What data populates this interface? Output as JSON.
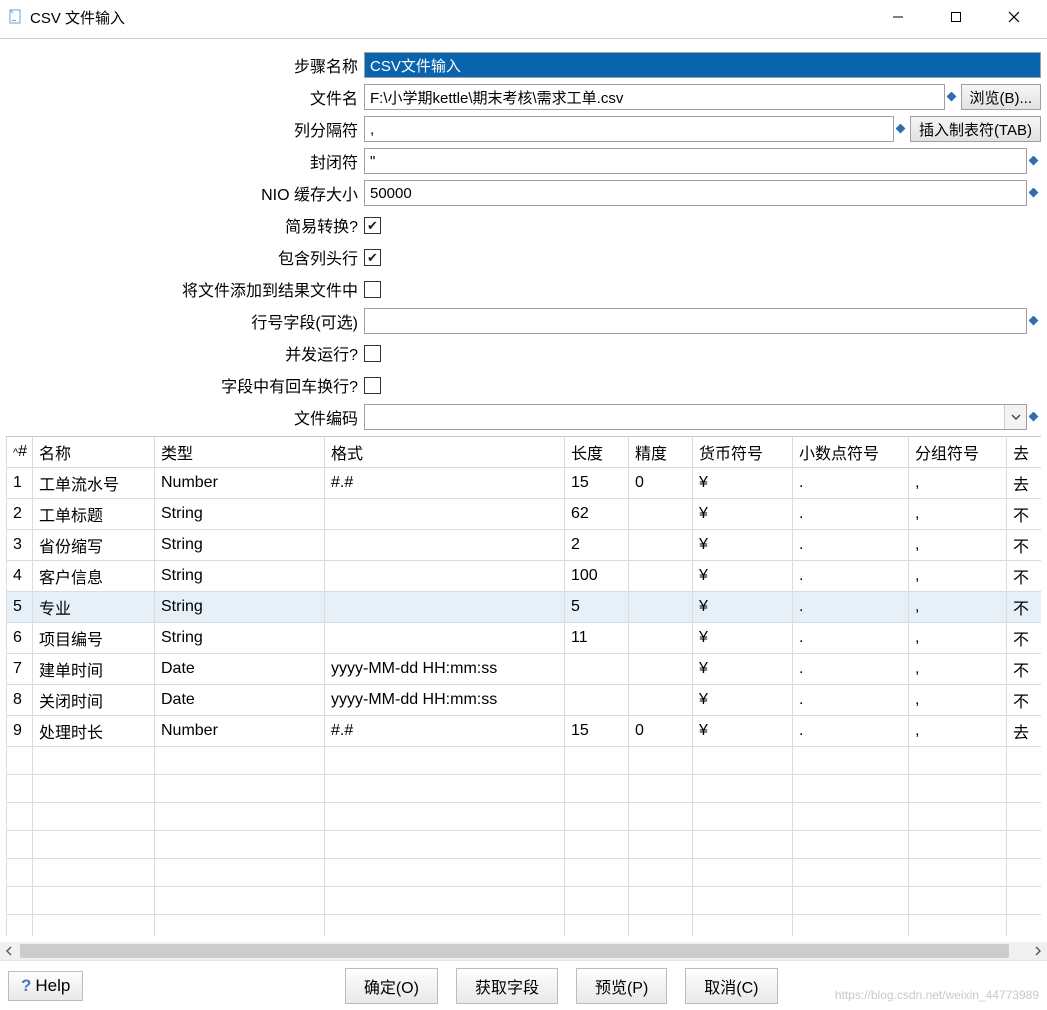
{
  "window": {
    "title": "CSV 文件输入"
  },
  "form": {
    "stepName": {
      "label": "步骤名称",
      "value": "CSV文件输入"
    },
    "fileName": {
      "label": "文件名",
      "value": "F:\\小学期kettle\\期末考核\\需求工单.csv",
      "browse": "浏览(B)..."
    },
    "delimiter": {
      "label": "列分隔符",
      "value": ",",
      "tabBtn": "插入制表符(TAB)"
    },
    "enclosure": {
      "label": "封闭符",
      "value": "\""
    },
    "nioBuffer": {
      "label": "NIO 缓存大小",
      "value": "50000"
    },
    "lazy": {
      "label": "简易转换?",
      "checked": true
    },
    "header": {
      "label": "包含列头行",
      "checked": true
    },
    "addResult": {
      "label": "将文件添加到结果文件中",
      "checked": false
    },
    "rowNum": {
      "label": "行号字段(可选)",
      "value": ""
    },
    "parallel": {
      "label": "并发运行?",
      "checked": false
    },
    "newlineIn": {
      "label": "字段中有回车换行?",
      "checked": false
    },
    "encoding": {
      "label": "文件编码",
      "value": ""
    }
  },
  "table": {
    "headers": {
      "idx": "#",
      "name": "名称",
      "type": "类型",
      "format": "格式",
      "length": "长度",
      "decimal": "精度",
      "currency": "货币符号",
      "decSym": "小数点符号",
      "grpSym": "分组符号",
      "trim": "去"
    },
    "rows": [
      {
        "idx": "1",
        "name": "工单流水号",
        "type": "Number",
        "format": "#.#",
        "length": "15",
        "decimal": "0",
        "currency": "¥",
        "decSym": ".",
        "grpSym": ",",
        "trim": "去"
      },
      {
        "idx": "2",
        "name": "工单标题",
        "type": "String",
        "format": "",
        "length": "62",
        "decimal": "",
        "currency": "¥",
        "decSym": ".",
        "grpSym": ",",
        "trim": "不"
      },
      {
        "idx": "3",
        "name": "省份缩写",
        "type": "String",
        "format": "",
        "length": "2",
        "decimal": "",
        "currency": "¥",
        "decSym": ".",
        "grpSym": ",",
        "trim": "不"
      },
      {
        "idx": "4",
        "name": "客户信息",
        "type": "String",
        "format": "",
        "length": "100",
        "decimal": "",
        "currency": "¥",
        "decSym": ".",
        "grpSym": ",",
        "trim": "不"
      },
      {
        "idx": "5",
        "name": "专业",
        "type": "String",
        "format": "",
        "length": "5",
        "decimal": "",
        "currency": "¥",
        "decSym": ".",
        "grpSym": ",",
        "trim": "不",
        "highlight": true
      },
      {
        "idx": "6",
        "name": "项目编号",
        "type": "String",
        "format": "",
        "length": "11",
        "decimal": "",
        "currency": "¥",
        "decSym": ".",
        "grpSym": ",",
        "trim": "不"
      },
      {
        "idx": "7",
        "name": "建单时间",
        "type": "Date",
        "format": "yyyy-MM-dd HH:mm:ss",
        "length": "",
        "decimal": "",
        "currency": "¥",
        "decSym": ".",
        "grpSym": ",",
        "trim": "不"
      },
      {
        "idx": "8",
        "name": "关闭时间",
        "type": "Date",
        "format": "yyyy-MM-dd HH:mm:ss",
        "length": "",
        "decimal": "",
        "currency": "¥",
        "decSym": ".",
        "grpSym": ",",
        "trim": "不"
      },
      {
        "idx": "9",
        "name": "处理时长",
        "type": "Number",
        "format": "#.#",
        "length": "15",
        "decimal": "0",
        "currency": "¥",
        "decSym": ".",
        "grpSym": ",",
        "trim": "去"
      }
    ],
    "emptyRows": 8
  },
  "footer": {
    "help": "Help",
    "ok": "确定(O)",
    "getFields": "获取字段",
    "preview": "预览(P)",
    "cancel": "取消(C)",
    "watermark": "https://blog.csdn.net/weixin_44773989"
  }
}
